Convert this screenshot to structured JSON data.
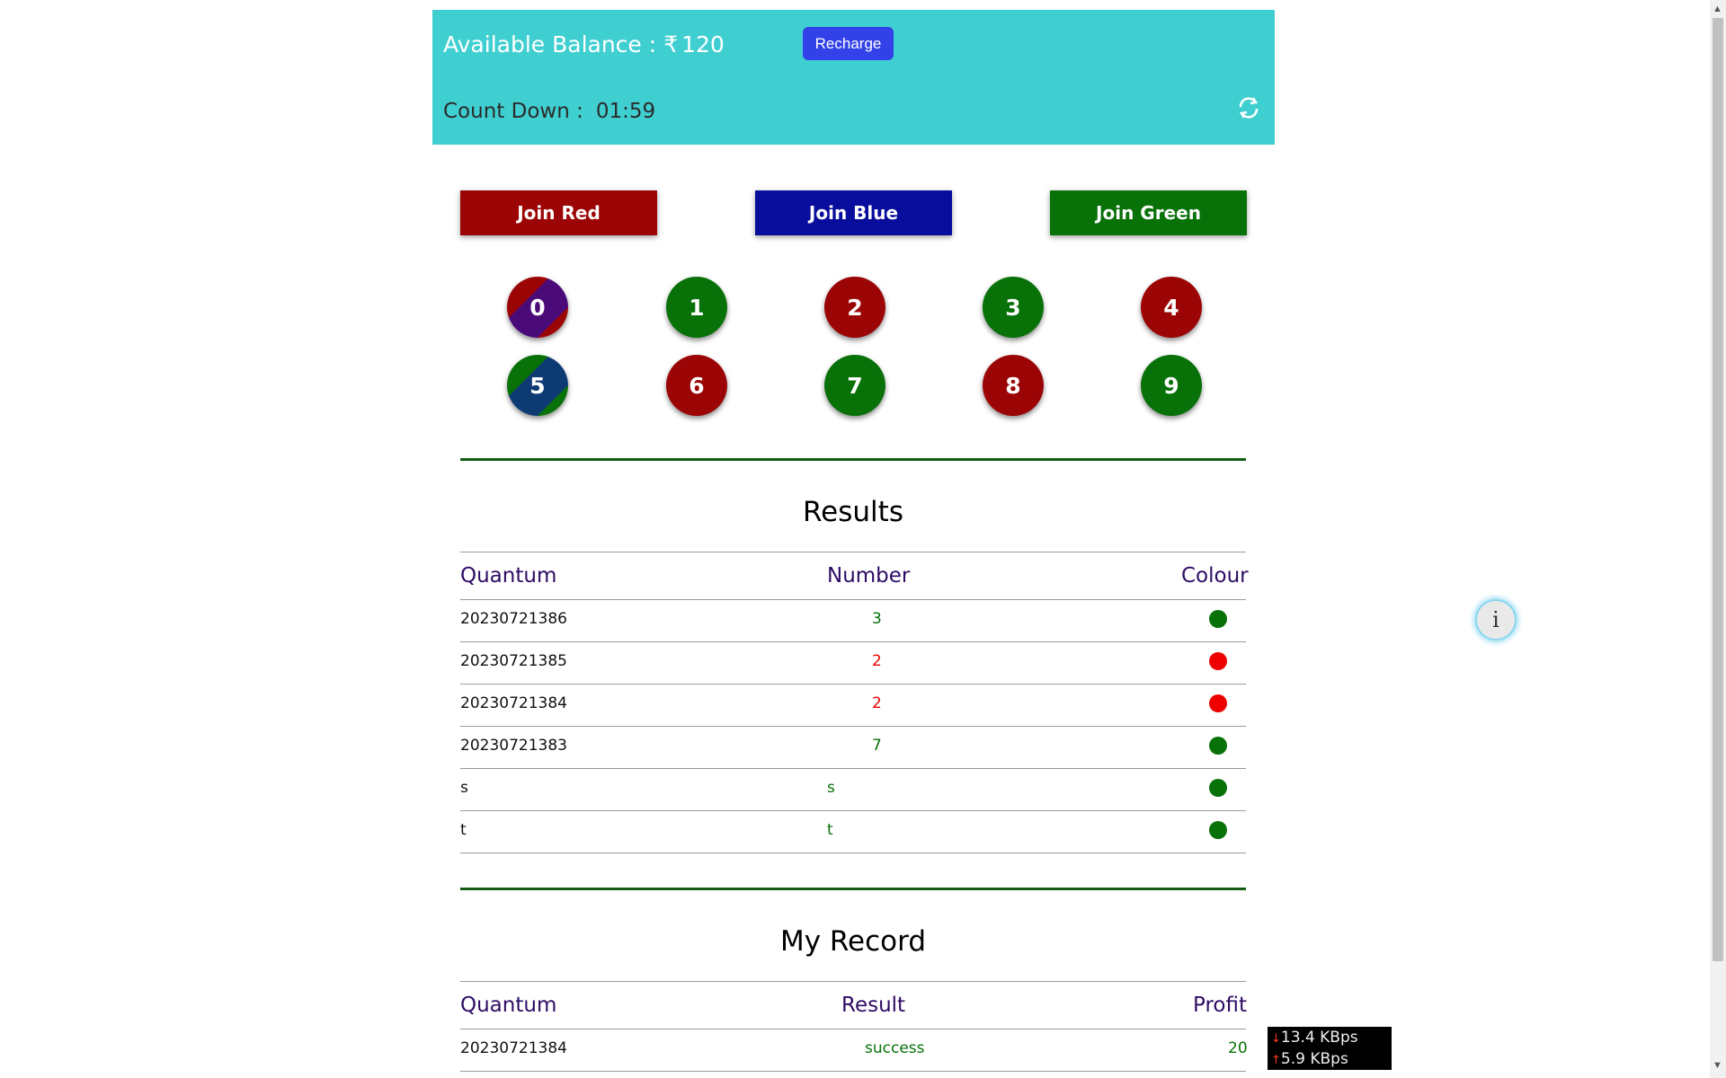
{
  "header": {
    "balance_label": "Available Balance :",
    "balance_currency": "₹",
    "balance_value": "120",
    "recharge_label": "Recharge",
    "countdown_label": "Count Down :",
    "countdown_value": "01:59",
    "refresh_icon": "refresh-icon"
  },
  "join_buttons": {
    "red": "Join Red",
    "blue": "Join Blue",
    "green": "Join Green"
  },
  "numbers": [
    "0",
    "1",
    "2",
    "3",
    "4",
    "5",
    "6",
    "7",
    "8",
    "9"
  ],
  "number_colors": {
    "0": "red-violet",
    "1": "green",
    "2": "red",
    "3": "green",
    "4": "red",
    "5": "green-violet",
    "6": "red",
    "7": "green",
    "8": "red",
    "9": "green"
  },
  "results": {
    "title": "Results",
    "headers": [
      "Quantum",
      "Number",
      "Colour"
    ],
    "rows": [
      {
        "quantum": "20230721386",
        "number": "3",
        "colour": "green"
      },
      {
        "quantum": "20230721385",
        "number": "2",
        "colour": "red"
      },
      {
        "quantum": "20230721384",
        "number": "2",
        "colour": "red"
      },
      {
        "quantum": "20230721383",
        "number": "7",
        "colour": "green"
      },
      {
        "quantum": "s",
        "number": "s",
        "colour": "green"
      },
      {
        "quantum": "t",
        "number": "t",
        "colour": "green"
      }
    ]
  },
  "my_record": {
    "title": "My Record",
    "headers": [
      "Quantum",
      "Result",
      "Profit"
    ],
    "rows": [
      {
        "quantum": "20230721384",
        "result": "success",
        "profit": "20"
      }
    ]
  },
  "info_button_icon": "info-icon",
  "network_monitor": {
    "down": "13.4 KBps",
    "up": "5.9 KBps"
  },
  "colors": {
    "header_bg": "#40cfd1",
    "recharge_bg": "#3342e8",
    "red": "#9b0505",
    "blue": "#080d9c",
    "green": "#087108",
    "bright_red": "#ee0000",
    "violet": "#4a0b79"
  }
}
